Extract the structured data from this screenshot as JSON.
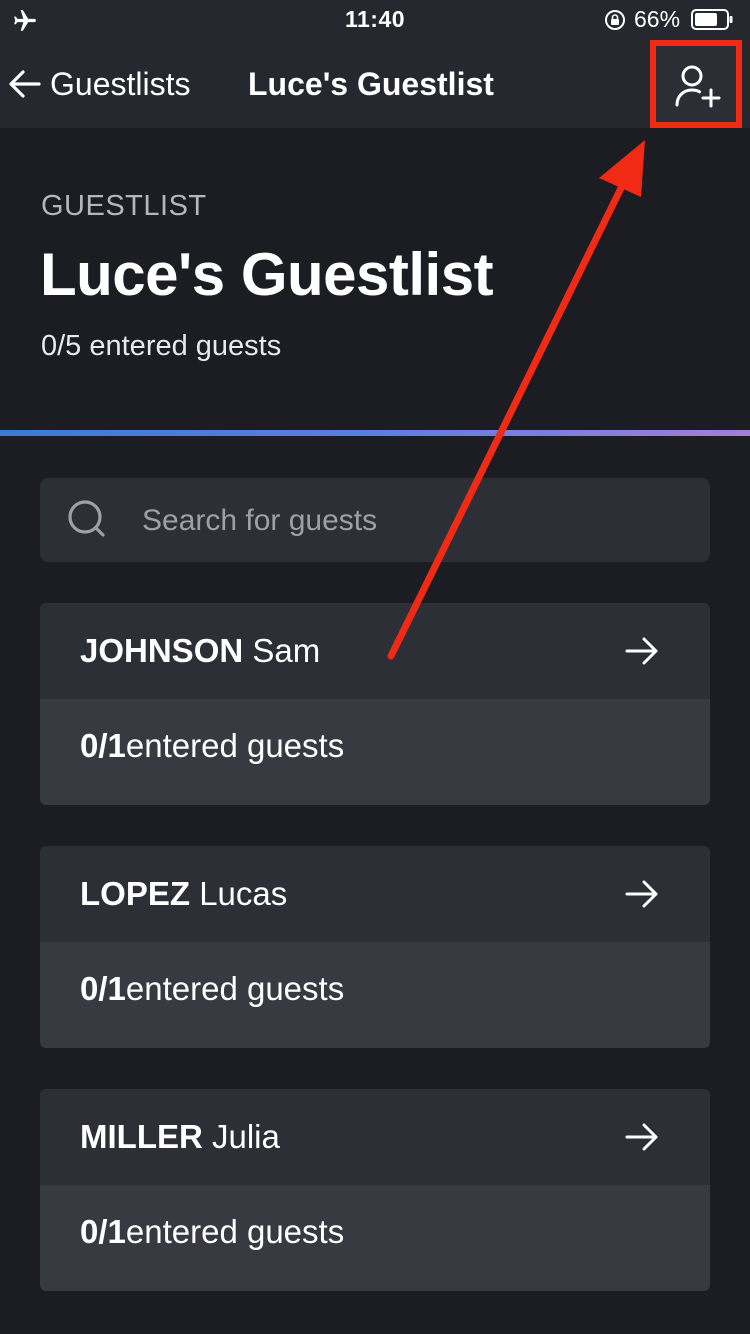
{
  "status_bar": {
    "time": "11:40",
    "battery_percent": "66%"
  },
  "nav": {
    "back_label": "Guestlists",
    "title": "Luce's Guestlist"
  },
  "header": {
    "eyebrow": "GUESTLIST",
    "title": "Luce's Guestlist",
    "summary": "0/5 entered guests"
  },
  "search": {
    "placeholder": "Search for guests"
  },
  "guests": [
    {
      "last_name": "JOHNSON",
      "first_name": "Sam",
      "entered_count": "0/1",
      "entered_label": "entered guests"
    },
    {
      "last_name": "LOPEZ",
      "first_name": "Lucas",
      "entered_count": "0/1",
      "entered_label": "entered guests"
    },
    {
      "last_name": "MILLER",
      "first_name": "Julia",
      "entered_count": "0/1",
      "entered_label": "entered guests"
    }
  ],
  "icons": {
    "airplane": "airplane-icon",
    "lock": "rotation-lock-icon",
    "battery": "battery-icon",
    "back": "arrow-left-icon",
    "add_guest": "add-person-icon",
    "search": "search-icon",
    "row_arrow": "arrow-right-icon"
  },
  "colors": {
    "background": "#1b1d22",
    "bar": "#25282f",
    "card_top": "#2c2f36",
    "card_bottom": "#373a41",
    "highlight": "#f02a15",
    "divider_start": "#3a7bd5",
    "divider_end": "#a57dd9"
  }
}
